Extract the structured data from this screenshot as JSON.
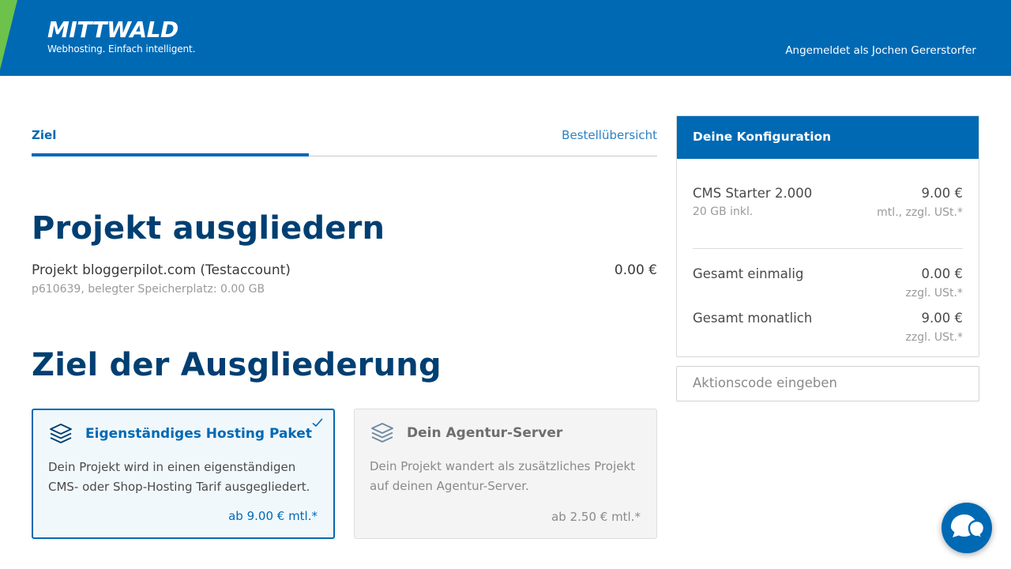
{
  "header": {
    "logo": "MITTWALD",
    "tagline": "Webhosting. Einfach intelligent.",
    "user_label": "Angemeldet als Jochen Gererstorfer",
    "brand_color": "#0069b4",
    "accent_color": "#6cc24a"
  },
  "tabs": [
    {
      "label": "Ziel",
      "active": true
    },
    {
      "label": "Bestellübersicht",
      "active": false
    }
  ],
  "main": {
    "title": "Projekt ausgliedern",
    "project": {
      "name": "Projekt bloggerpilot.com (Testaccount)",
      "details": "p610639, belegter Speicherplatz: 0.00 GB",
      "price": "0.00 €"
    },
    "target_title": "Ziel der Ausgliederung",
    "options": [
      {
        "icon": "layers-icon",
        "title": "Eigenständiges Hosting Paket",
        "description": "Dein Projekt wird in einen eigenständigen CMS- oder Shop-Hosting Tarif ausgegliedert.",
        "price": "ab 9.00 € mtl.*",
        "selected": true
      },
      {
        "icon": "layers-icon",
        "title": "Dein Agentur-Server",
        "description": "Dein Projekt wandert als zusätzliches Projekt auf deinen Agentur-Server.",
        "price": "ab 2.50 € mtl.*",
        "selected": false
      }
    ]
  },
  "config": {
    "title": "Deine Konfiguration",
    "product": {
      "name": "CMS Starter 2.000",
      "sub": "20 GB inkl.",
      "price": "9.00 €",
      "price_note": "mtl., zzgl. USt.*"
    },
    "once": {
      "label": "Gesamt einmalig",
      "price": "0.00 €",
      "note": "zzgl. USt.*"
    },
    "monthly": {
      "label": "Gesamt monatlich",
      "price": "9.00 €",
      "note": "zzgl. USt.*"
    }
  },
  "promo": {
    "placeholder": "Aktionscode eingeben"
  },
  "chat": {
    "icon": "chat-icon"
  }
}
